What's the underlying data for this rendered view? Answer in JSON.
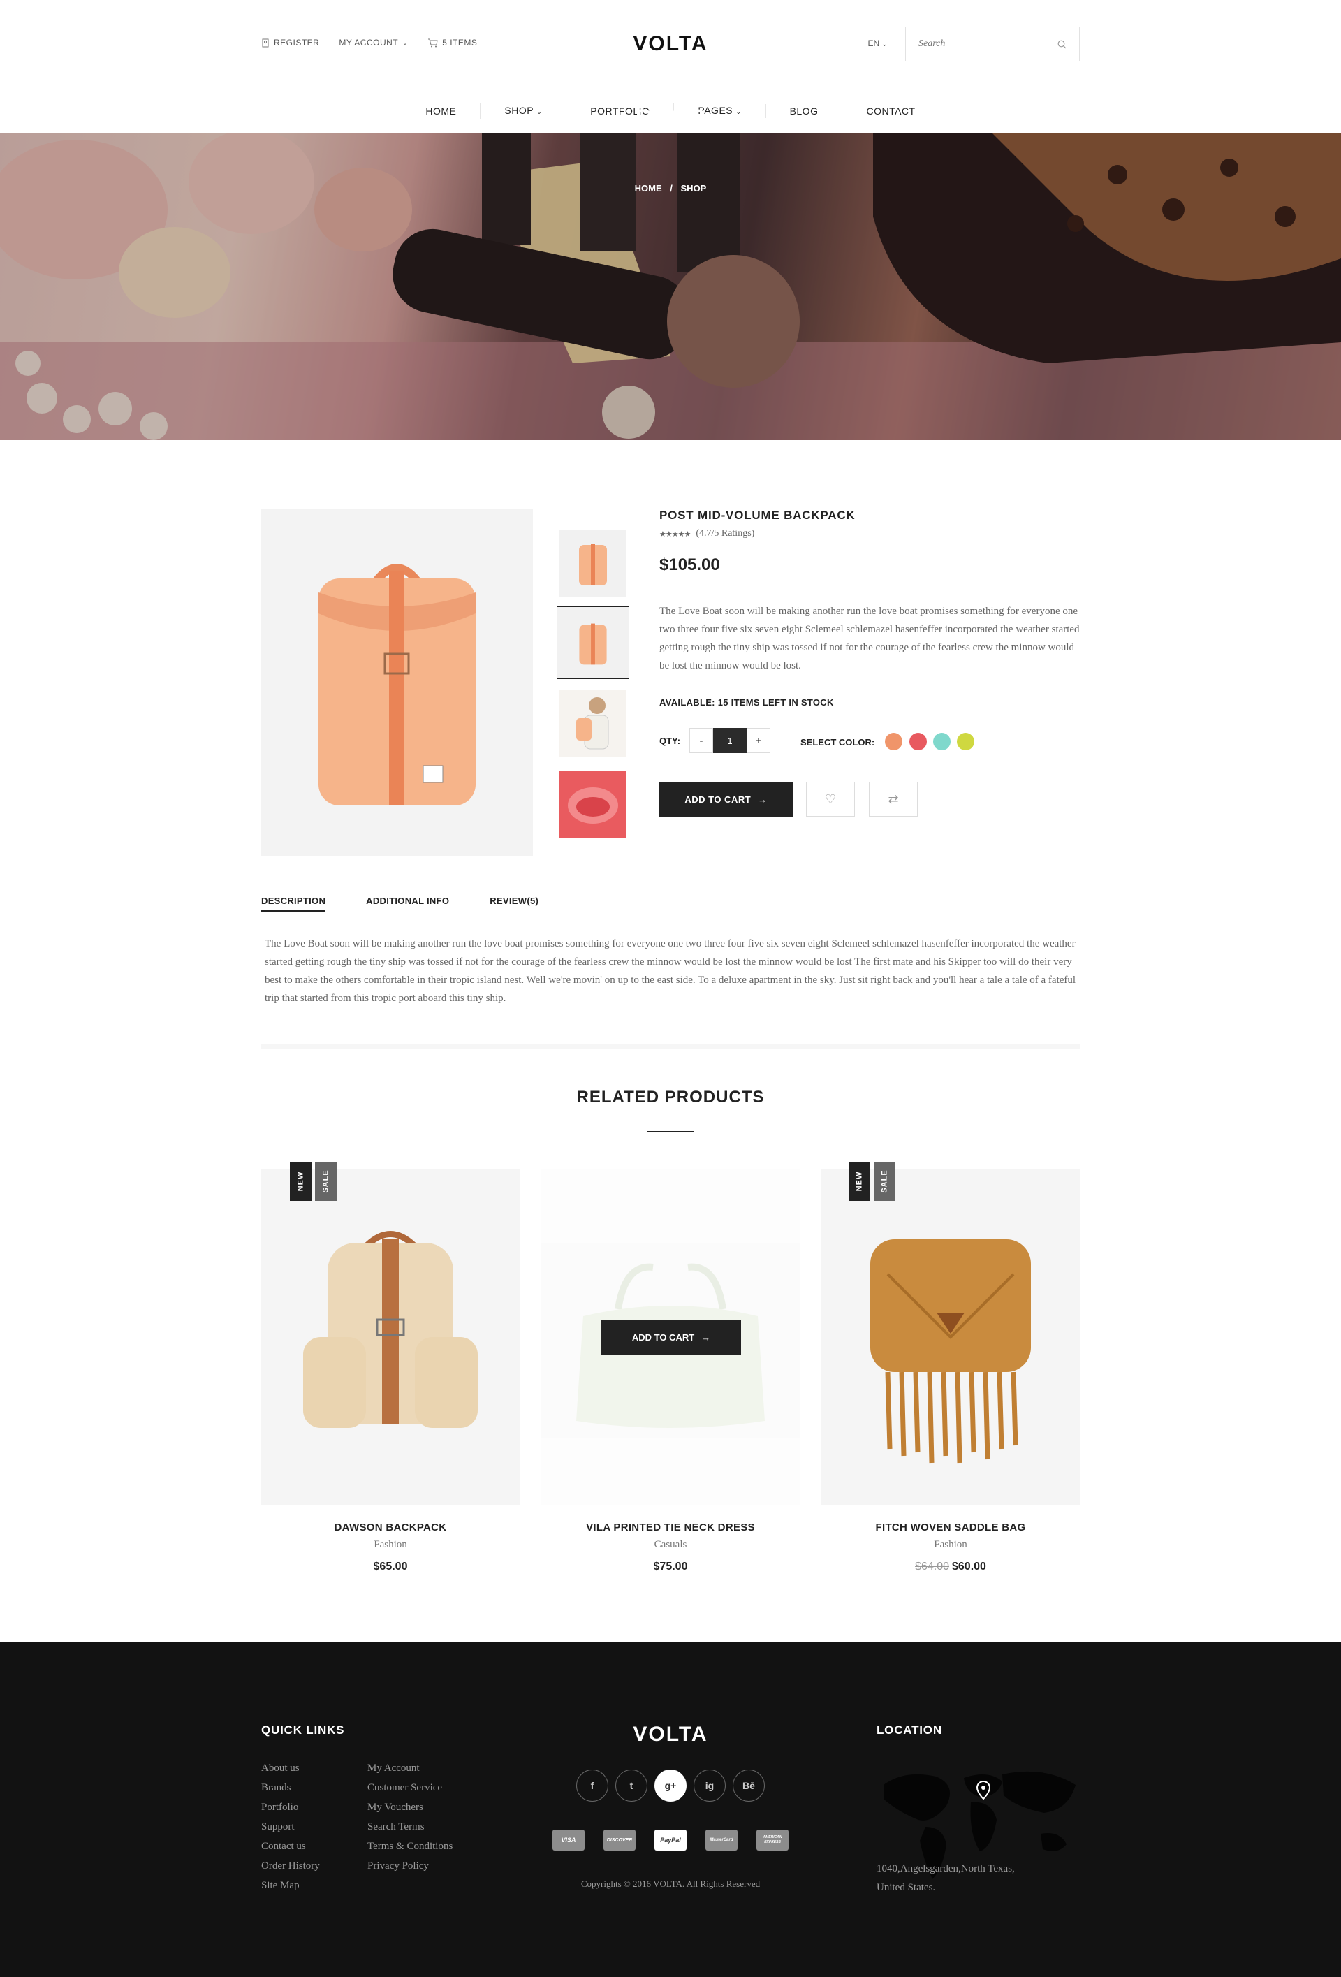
{
  "header": {
    "register": "REGISTER",
    "my_account": "MY ACCOUNT",
    "cart_items": "5 ITEMS",
    "logo": "VOLTA",
    "language": "EN",
    "search_placeholder": "Search"
  },
  "nav": [
    "HOME",
    "SHOP",
    "PORTFOLIO",
    "PAGES",
    "BLOG",
    "CONTACT"
  ],
  "hero": {
    "title": "SHOP",
    "crumb_home": "HOME",
    "crumb_sep": "/",
    "crumb_current": "SHOP"
  },
  "product": {
    "name": "POST MID-VOLUME BACKPACK",
    "rating": 4.7,
    "rating_text": "(4.7/5 Ratings)",
    "price": "$105.00",
    "description": "The Love Boat soon will be making another run the love boat promises something for everyone one two three four five six seven eight Sclemeel schlemazel hasenfeffer incorporated the weather started getting rough the tiny ship was tossed if not for the courage of the fearless crew the minnow would be lost the minnow would be lost.",
    "availability": "AVAILABLE: 15 ITEMS LEFT IN STOCK",
    "qty_label": "QTY:",
    "qty_minus": "-",
    "qty_value": "1",
    "qty_plus": "+",
    "color_label": "SELECT COLOR:",
    "colors": [
      "#f0956a",
      "#e8595f",
      "#7fd8cc",
      "#cfd840"
    ],
    "add_to_cart": "ADD TO CART",
    "thumbnails": [
      "backpack-front",
      "backpack-front-active",
      "model-backpack",
      "red-bag-inside"
    ]
  },
  "tabs": {
    "items": [
      "DESCRIPTION",
      "ADDITIONAL INFO",
      "REVIEW(5)"
    ],
    "active": "DESCRIPTION",
    "body": "The Love Boat soon will be making another run the love boat promises something for everyone one two three four five six seven eight Sclemeel schlemazel hasenfeffer incorporated the weather started getting rough the tiny ship was tossed if not for the courage of the fearless crew the minnow would be lost the minnow would be lost  The first mate and his Skipper too will do their very best to make the others comfortable in their tropic island nest. Well we're movin' on up to the east side. To a deluxe apartment in the sky. Just sit right back and you'll hear a tale a tale of a fateful trip that started from this tropic port aboard this tiny ship."
  },
  "related": {
    "title": "RELATED PRODUCTS",
    "badge_new": "NEW",
    "badge_sale": "SALE",
    "hover_cart": "ADD TO CART",
    "items": [
      {
        "name": "DAWSON BACKPACK",
        "category": "Fashion",
        "price": "$65.00",
        "old_price": ""
      },
      {
        "name": "VILA PRINTED TIE NECK DRESS",
        "category": "Casuals",
        "price": "$75.00",
        "old_price": ""
      },
      {
        "name": "FITCH WOVEN SADDLE BAG",
        "category": "Fashion",
        "price": "$60.00",
        "old_price": "$64.00"
      }
    ]
  },
  "footer": {
    "quick_links_title": "QUICK LINKS",
    "links_col1": [
      "About us",
      "Brands",
      "Portfolio",
      "Support",
      "Contact us",
      "Order History",
      "Site Map"
    ],
    "links_col2": [
      "My Account",
      "Customer Service",
      "My Vouchers",
      "Search Terms",
      "Terms & Conditions",
      "Privacy Policy"
    ],
    "logo": "VOLTA",
    "social": [
      "f",
      "t",
      "g+",
      "ig",
      "Bē"
    ],
    "payments": [
      "VISA",
      "DISCOVER",
      "PayPal",
      "MasterCard",
      "AMERICAN EXPRESS"
    ],
    "copyright": "Copyrights © 2016 VOLTA. All Rights Reserved",
    "location_title": "LOCATION",
    "address_line1": "1040,Angelsgarden,North Texas,",
    "address_line2": "United States."
  }
}
